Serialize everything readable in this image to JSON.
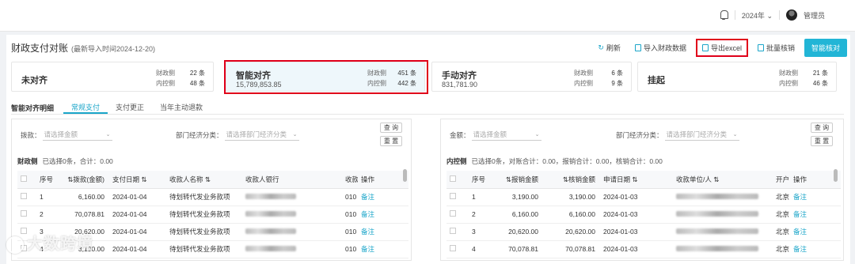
{
  "topbar": {
    "year": "2024年",
    "user": "管理员"
  },
  "page": {
    "title": "财政支付对账",
    "subtitle": "(最新导入时间2024-12-20)"
  },
  "actions": {
    "refresh": "刷新",
    "import_finance": "导入财政数据",
    "export_excel": "导出excel",
    "batch_verify": "批量核销",
    "smart_verify": "智能核对"
  },
  "cards": [
    {
      "name": "未对齐",
      "amount": "",
      "left_label": "财政侧",
      "left_count": "22 条",
      "right_label": "内控侧",
      "right_count": "48 条"
    },
    {
      "name": "智能对齐",
      "amount": "15,789,853.85",
      "left_label": "财政侧",
      "left_count": "451 条",
      "right_label": "内控侧",
      "right_count": "442 条"
    },
    {
      "name": "手动对齐",
      "amount": "831,781.90",
      "left_label": "财政侧",
      "left_count": "6 条",
      "right_label": "内控侧",
      "right_count": "9 条"
    },
    {
      "name": "挂起",
      "amount": "",
      "left_label": "财政侧",
      "left_count": "21 条",
      "right_label": "内控侧",
      "right_count": "46 条"
    }
  ],
  "tabs": {
    "label": "智能对齐明细",
    "items": [
      "常规支付",
      "支付更正",
      "当年主动退款"
    ]
  },
  "left": {
    "filter1_label": "拨款：",
    "filter1_placeholder": "请选择金额",
    "filter2_label": "部门经济分类：",
    "filter2_placeholder": "请选择部门经济分类",
    "query": "查 询",
    "reset": "重 置",
    "summary_title": "财政侧",
    "summary_text": "已选择0条，合计：0.00",
    "columns": [
      "序号",
      "⇅拨款(金额)",
      "支付日期 ⇅",
      "收款人名称 ⇅",
      "收款人银行",
      "收款",
      "操作"
    ],
    "rows": [
      [
        "1",
        "6,160.00",
        "2024-01-04",
        "待划转代发业务款项",
        "010",
        "备注"
      ],
      [
        "2",
        "70,078.81",
        "2024-01-04",
        "待划转代发业务款项",
        "010",
        "备注"
      ],
      [
        "3",
        "20,620.00",
        "2024-01-04",
        "待划转代发业务款项",
        "010",
        "备注"
      ],
      [
        "4",
        "3,190.00",
        "2024-01-04",
        "待划转代发业务款项",
        "010",
        "备注"
      ]
    ]
  },
  "right": {
    "filter1_label": "金额：",
    "filter1_placeholder": "请选择金额",
    "filter2_label": "部门经济分类：",
    "filter2_placeholder": "请选择部门经济分类",
    "query": "查 询",
    "reset": "重 置",
    "summary_title": "内控侧",
    "summary_text": "已选择0条，对账合计：0.00，报销合计：0.00，核销合计：0.00",
    "columns": [
      "序号",
      "⇅报销金额",
      "⇅核销金额",
      "申请日期 ⇅",
      "收款单位/人 ⇅",
      "开户",
      "操作"
    ],
    "rows": [
      [
        "1",
        "3,190.00",
        "3,190.00",
        "2024-01-03",
        "北京",
        "备注"
      ],
      [
        "2",
        "6,160.00",
        "6,160.00",
        "2024-01-03",
        "北京",
        "备注"
      ],
      [
        "3",
        "20,620.00",
        "20,620.00",
        "2024-01-03",
        "北京",
        "备注"
      ],
      [
        "4",
        "70,078.81",
        "70,078.81",
        "2024-01-03",
        "北京",
        "备注"
      ]
    ]
  },
  "watermark": "大数跨境"
}
